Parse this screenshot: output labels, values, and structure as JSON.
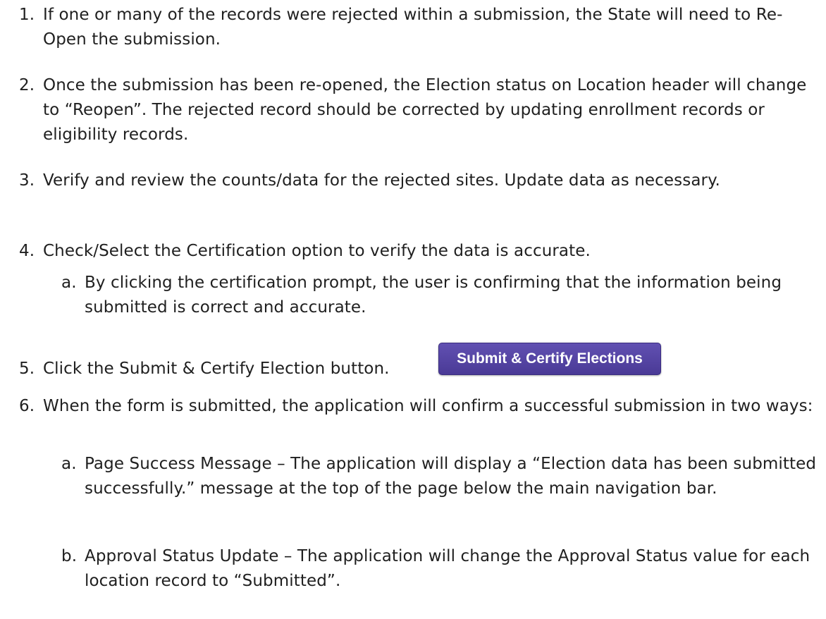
{
  "steps": [
    {
      "num": "1.",
      "text": "If one or many of the records were rejected within a submission, the State will need to Re-Open the submission."
    },
    {
      "num": "2.",
      "text": "Once the submission has been re-opened, the Election status on Location header will change to “Reopen”. The rejected record should be corrected by updating enrollment records or eligibility records."
    },
    {
      "num": "3.",
      "text": "Verify and review the counts/data for the rejected sites. Update data as necessary."
    },
    {
      "num": "4.",
      "text": "Check/Select the Certification option to verify the data is accurate.",
      "substeps": [
        {
          "num": "a.",
          "text": "By clicking the certification prompt, the user is confirming that the information being submitted is correct and accurate."
        }
      ]
    },
    {
      "num": "5.",
      "text": "Click the Submit & Certify Election button."
    },
    {
      "num": "6.",
      "text": "When the form is submitted, the application will confirm a successful submission in two ways:",
      "substeps": [
        {
          "num": "a.",
          "text": "Page Success Message – The application will display a “Election data has been submitted successfully.” message at the top of the page below the main navigation bar."
        },
        {
          "num": "b.",
          "text": "Approval Status Update – The application will change the Approval Status value for each location record to “Submitted”."
        }
      ]
    }
  ],
  "submit_button": {
    "label": "Submit & Certify Elections"
  },
  "colors": {
    "button_bg": "#5545a8",
    "button_text": "#ffffff",
    "body_text": "#1f1f1f"
  }
}
